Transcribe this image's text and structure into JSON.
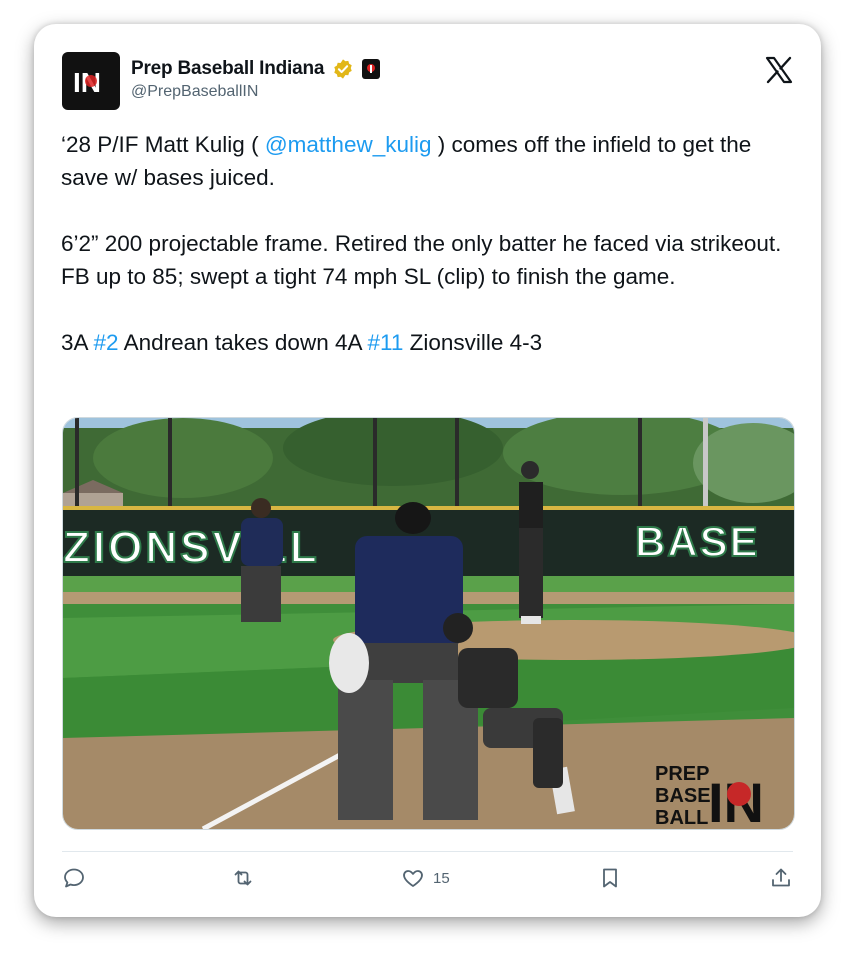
{
  "account": {
    "display_name": "Prep Baseball Indiana",
    "handle": "@PrepBaseballIN",
    "avatar_text": "IN"
  },
  "tweet": {
    "line1_pre": "‘28 P/IF Matt Kulig ( ",
    "mention": "@matthew_kulig",
    "line1_post": " ) comes off the infield to get the save w/ bases juiced.",
    "para2": "6’2” 200 projectable frame. Retired the only batter he faced via strikeout. FB up to 85; swept a tight 74 mph SL (clip) to finish the game.",
    "para3_a": "3A ",
    "hashtag1": "#2",
    "para3_b": " Andrean takes down 4A ",
    "hashtag2": "#11",
    "para3_c": " Zionsville 4-3"
  },
  "media": {
    "wall_left_text": "ZIONSVILL",
    "wall_right_text": "BASE",
    "watermark": [
      "PREP",
      "BASE",
      "BALL"
    ],
    "watermark_logo": "IN"
  },
  "actions": {
    "like_count": "15"
  },
  "icons": [
    "verified-badge-icon",
    "affiliate-badge-icon",
    "x-logo-icon",
    "reply-icon",
    "retweet-icon",
    "like-icon",
    "bookmark-icon",
    "share-icon"
  ],
  "colors": {
    "link": "#1d9bf0",
    "verified": "#e2b719",
    "secondary_text": "#536471"
  }
}
